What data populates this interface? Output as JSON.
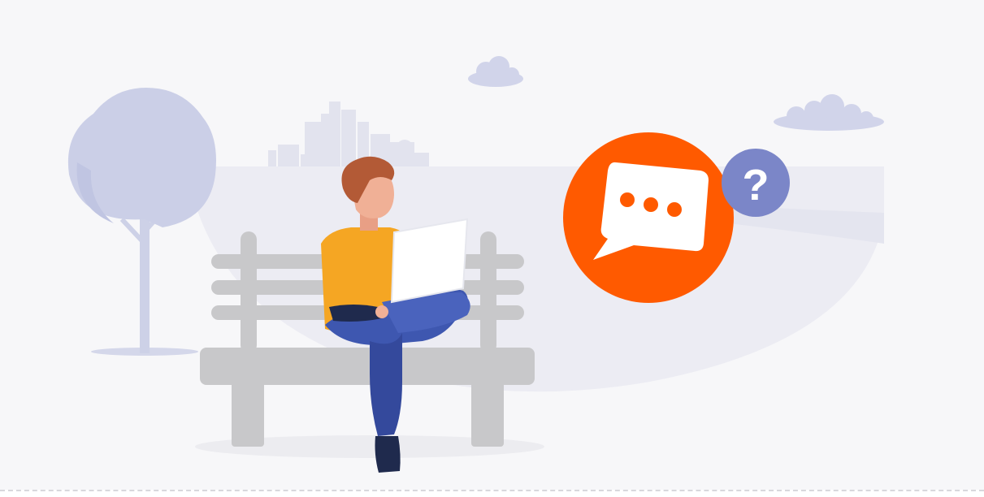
{
  "illustration": {
    "subject": "person-on-bench-with-laptop",
    "speech_bubble_glyph": "...",
    "question_glyph": "?"
  },
  "colors": {
    "background": "#f6f6f8",
    "scene_fill": "#eeeef4",
    "lavender": "#ccd0e8",
    "bench": "#c9c9cb",
    "accent_orange": "#ff5a00",
    "question_purple": "#7b86c8",
    "shirt": "#f5a623",
    "pants": "#3e57b0",
    "hair": "#b35a36",
    "skin": "#f0b096",
    "laptop": "#ffffff"
  }
}
